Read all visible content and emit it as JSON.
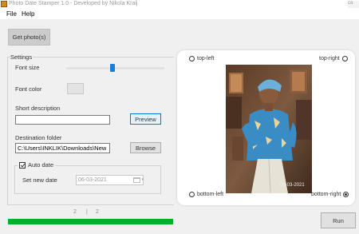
{
  "window": {
    "title": "Photo Date Stamper 1.0 - Developed by Nikola Kralj",
    "controls": "ca"
  },
  "menu": {
    "items": [
      "File",
      "Help"
    ]
  },
  "toolbar": {
    "get_photos_label": "Get photo(s)"
  },
  "settings": {
    "legend": "Settings",
    "font_size_label": "Font size",
    "font_size_slider_fraction": 0.47,
    "font_color_label": "Font color",
    "font_color_value": "#e3e3e3",
    "short_description_label": "Short description",
    "short_description_value": "",
    "preview_label": "Preview",
    "destination_label": "Destination folder",
    "destination_value": "C:\\Users\\INKLIK\\Downloads\\New",
    "browse_label": "Browse",
    "auto_date": {
      "label": "Auto date",
      "checked": true,
      "set_new_date_label": "Set new date",
      "date_value": "06-03-2021"
    }
  },
  "status": {
    "current": "2",
    "separator": "|",
    "total": "2",
    "progress_fraction": 1.0,
    "progress_color": "#06b025"
  },
  "run_label": "Run",
  "preview": {
    "positions": {
      "top_left": "top-left",
      "top_right": "top-right",
      "bottom_left": "bottom-left",
      "bottom_right": "bottom-right",
      "selected": "bottom-right"
    },
    "stamp_text": "06-03-2021"
  },
  "colors": {
    "accent": "#0078d7",
    "slider": "#1b7fd1"
  }
}
